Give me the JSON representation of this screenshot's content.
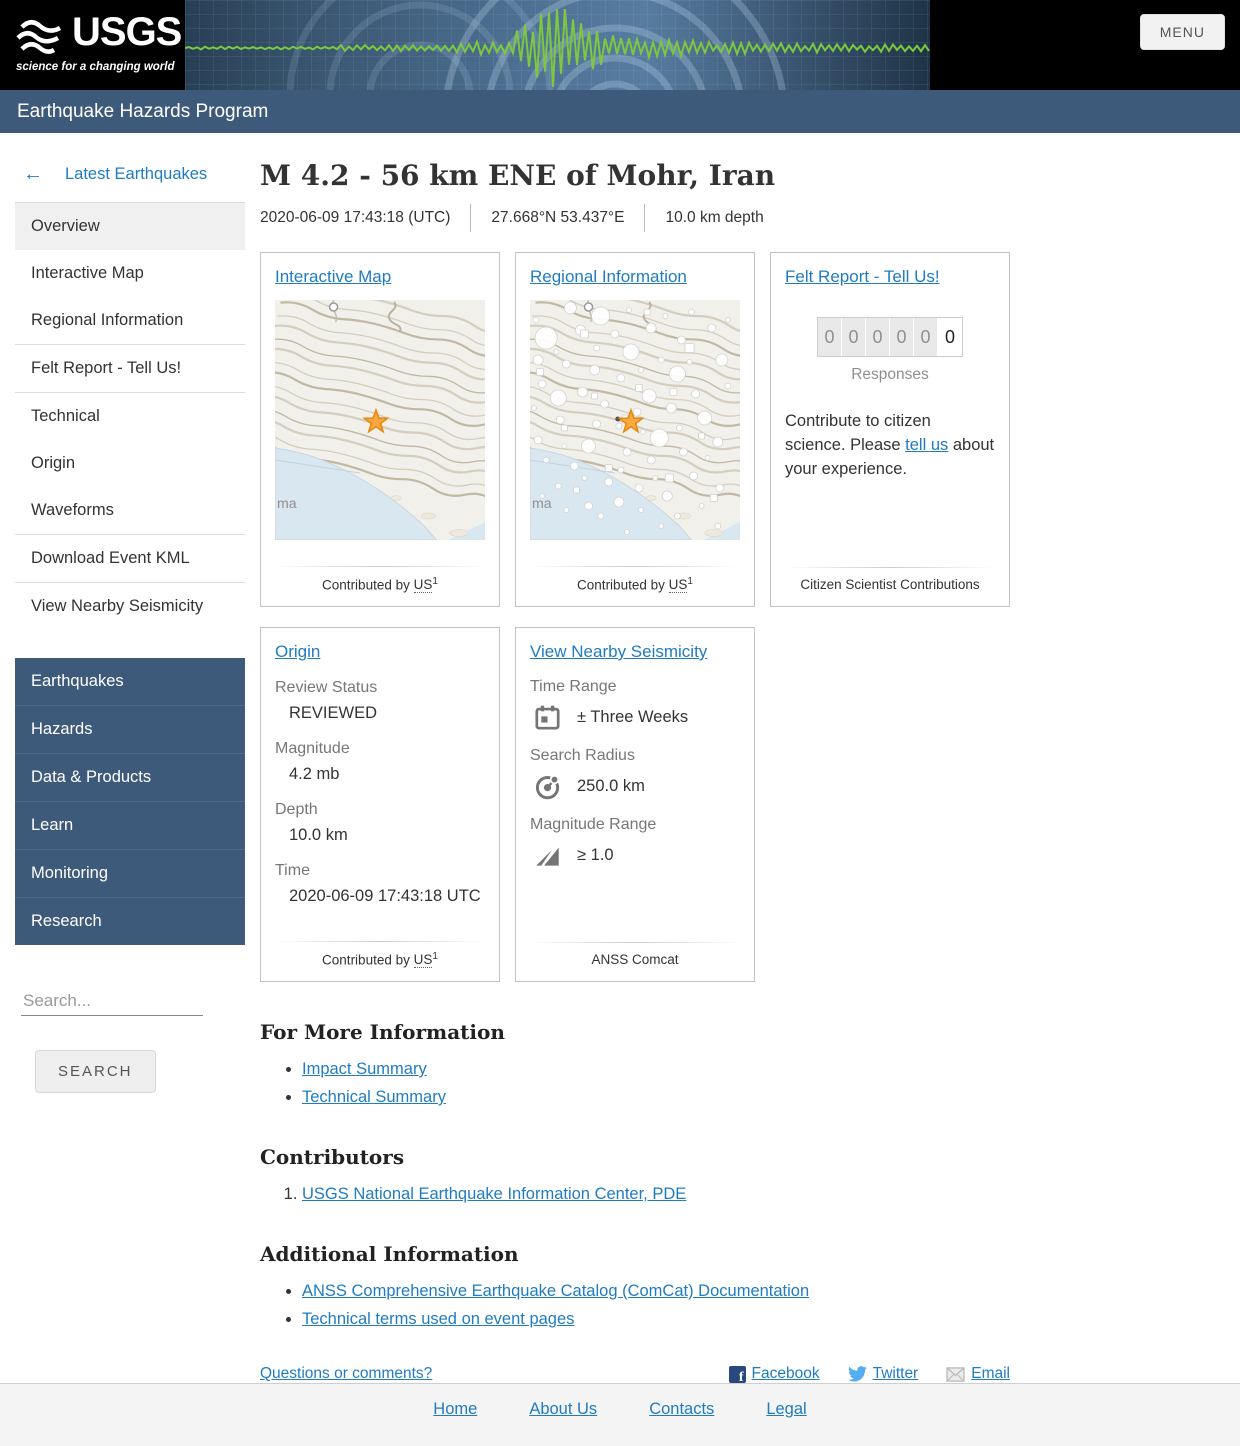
{
  "header": {
    "logo_text": "USGS",
    "logo_tagline": "science for a changing world",
    "menu_label": "MENU",
    "program_title": "Earthquake Hazards Program"
  },
  "sidebar": {
    "back_label": "Latest Earthquakes",
    "nav": [
      "Overview",
      "Interactive Map",
      "Regional Information",
      "Felt Report - Tell Us!",
      "Technical",
      "Origin",
      "Waveforms",
      "Download Event KML",
      "View Nearby Seismicity"
    ],
    "site_nav": [
      "Earthquakes",
      "Hazards",
      "Data & Products",
      "Learn",
      "Monitoring",
      "Research"
    ],
    "search_placeholder": "Search...",
    "search_button_label": "SEARCH"
  },
  "event": {
    "title": "M 4.2 - 56 km ENE of Mohr, Iran",
    "origin_time": "2020-06-09 17:43:18 (UTC)",
    "coordinates": "27.668°N 53.437°E",
    "depth": "10.0 km depth"
  },
  "cards": {
    "interactive_map": {
      "title": "Interactive Map",
      "map_label": "ma",
      "footer_prefix": "Contributed by",
      "contributor": "US",
      "footnote": "1"
    },
    "regional_information": {
      "title": "Regional Information",
      "map_label": "ma",
      "footer_prefix": "Contributed by",
      "contributor": "US",
      "footnote": "1"
    },
    "felt_report": {
      "title": "Felt Report - Tell Us!",
      "counter_digits": [
        "0",
        "0",
        "0",
        "0",
        "0",
        "0"
      ],
      "counter_label": "Responses",
      "body_before": "Contribute to citizen science. Please ",
      "body_link": "tell us",
      "body_after": " about your experience.",
      "footer": "Citizen Scientist Contributions"
    },
    "origin": {
      "title": "Origin",
      "fields": [
        {
          "label": "Review Status",
          "value": "REVIEWED"
        },
        {
          "label": "Magnitude",
          "value": "4.2 mb"
        },
        {
          "label": "Depth",
          "value": "10.0 km"
        },
        {
          "label": "Time",
          "value": "2020-06-09 17:43:18 UTC"
        }
      ],
      "footer_prefix": "Contributed by",
      "contributor": "US",
      "footnote": "1"
    },
    "nearby_seismicity": {
      "title": "View Nearby Seismicity",
      "fields": [
        {
          "label": "Time Range",
          "value": "± Three Weeks",
          "icon": "calendar-icon"
        },
        {
          "label": "Search Radius",
          "value": "250.0 km",
          "icon": "radius-icon"
        },
        {
          "label": "Magnitude Range",
          "value": "≥ 1.0",
          "icon": "magnitude-icon"
        }
      ],
      "footer": "ANSS Comcat"
    }
  },
  "sections": [
    {
      "heading": "For More Information",
      "links": [
        "Impact Summary",
        "Technical Summary"
      ]
    },
    {
      "heading": "Contributors",
      "links": [
        "USGS National Earthquake Information Center, PDE"
      ]
    },
    {
      "heading": "Additional Information",
      "links": [
        "ANSS Comprehensive Earthquake Catalog (ComCat) Documentation",
        "Technical terms used on event pages"
      ]
    }
  ],
  "bottom": {
    "questions_label": "Questions or comments?",
    "social": [
      "Facebook",
      "Twitter",
      "Email"
    ]
  },
  "footer": {
    "links": [
      "Home",
      "About Us",
      "Contacts",
      "Legal"
    ]
  },
  "colors": {
    "link_blue": "#1f7cc1",
    "slate_blue": "#3e5a7a",
    "star_orange": "#f9a93d",
    "waveform_green": "#7cc83f"
  }
}
